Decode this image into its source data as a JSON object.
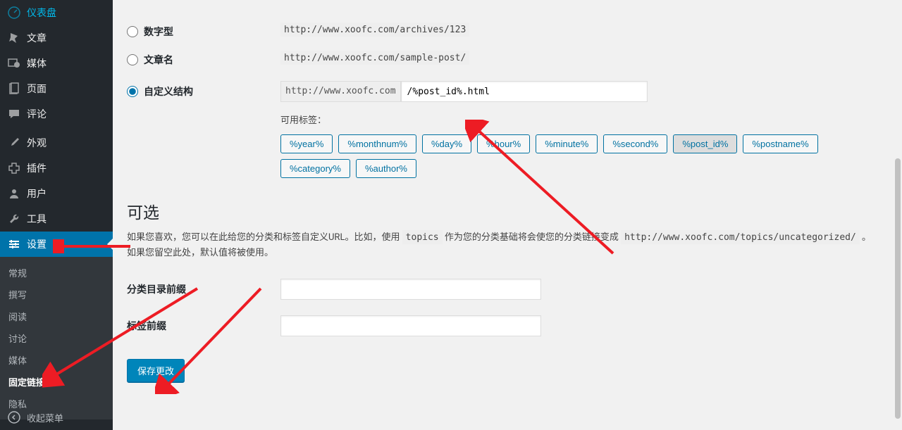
{
  "sidebar": {
    "items": [
      {
        "label": "仪表盘",
        "icon": "dashboard"
      },
      {
        "label": "文章",
        "icon": "pin"
      },
      {
        "label": "媒体",
        "icon": "media"
      },
      {
        "label": "页面",
        "icon": "page"
      },
      {
        "label": "评论",
        "icon": "comment"
      },
      {
        "label": "外观",
        "icon": "brush"
      },
      {
        "label": "插件",
        "icon": "plugin"
      },
      {
        "label": "用户",
        "icon": "users"
      },
      {
        "label": "工具",
        "icon": "tools"
      },
      {
        "label": "设置",
        "icon": "settings"
      }
    ],
    "submenu": [
      {
        "label": "常规"
      },
      {
        "label": "撰写"
      },
      {
        "label": "阅读"
      },
      {
        "label": "讨论"
      },
      {
        "label": "媒体"
      },
      {
        "label": "固定链接"
      },
      {
        "label": "隐私"
      }
    ],
    "collapse_label": "收起菜单"
  },
  "permalink": {
    "options": [
      {
        "label": "数字型",
        "example": "http://www.xoofc.com/archives/123"
      },
      {
        "label": "文章名",
        "example": "http://www.xoofc.com/sample-post/"
      },
      {
        "label": "自定义结构"
      }
    ],
    "base_url": "http://www.xoofc.com",
    "custom_value": "/%post_id%.html",
    "tags_label": "可用标签：",
    "tags": [
      "%year%",
      "%monthnum%",
      "%day%",
      "%hour%",
      "%minute%",
      "%second%",
      "%post_id%",
      "%postname%",
      "%category%",
      "%author%"
    ]
  },
  "optional": {
    "heading": "可选",
    "desc_pre": "如果您喜欢，您可以在此给您的分类和标签自定义URL。比如，使用 ",
    "desc_code1": "topics",
    "desc_mid": " 作为您的分类基础将会使您的分类链接变成 ",
    "desc_code2": "http://www.xoofc.com/topics/uncategorized/",
    "desc_post": " 。如果您留空此处，默认值将被使用。",
    "category_label": "分类目录前缀",
    "tag_label": "标签前缀"
  },
  "save_label": "保存更改"
}
